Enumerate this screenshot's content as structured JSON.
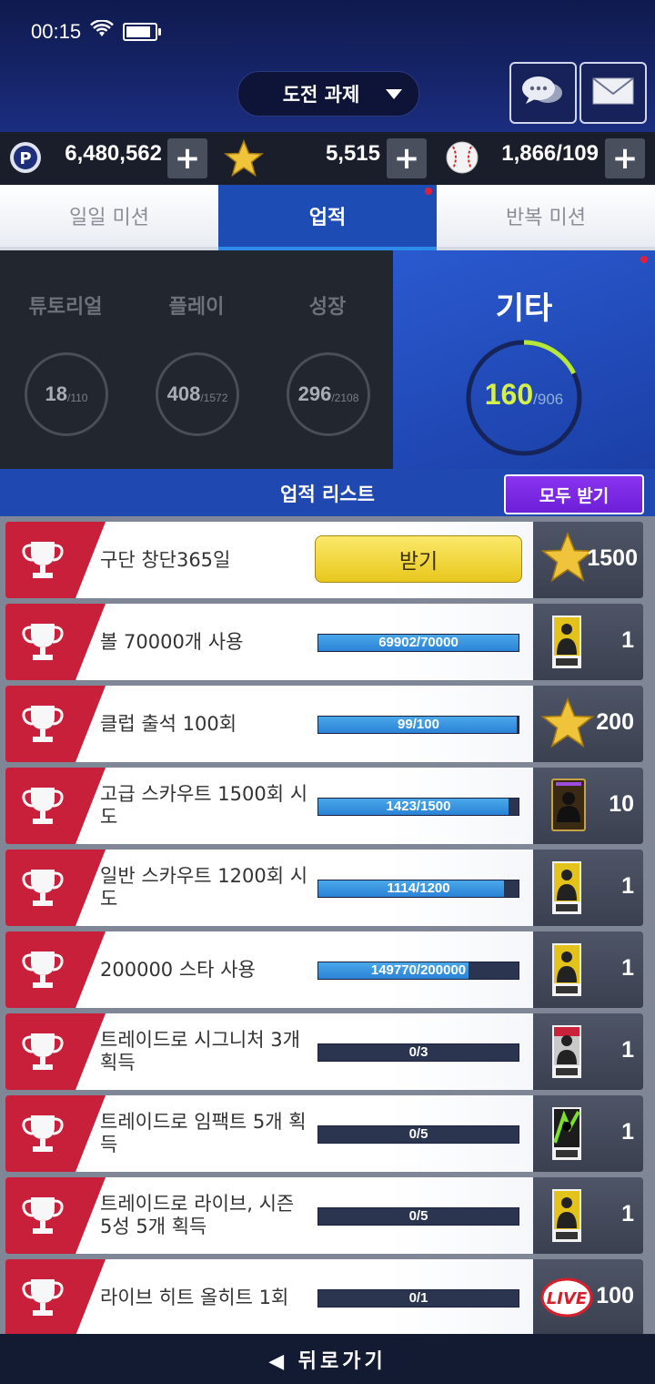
{
  "status": {
    "time": "00:15"
  },
  "header": {
    "dropdown_label": "도전 과제",
    "chat_icon": "chat-bubbles-icon",
    "mail_icon": "mail-envelope-icon"
  },
  "currency": {
    "points": "6,480,562",
    "stars": "5,515",
    "balls": "1,866/109",
    "plus": "+"
  },
  "tabs": [
    {
      "label": "일일 미션"
    },
    {
      "label": "업적"
    },
    {
      "label": "반복 미션"
    }
  ],
  "categories": [
    {
      "name": "튜토리얼",
      "value": "18",
      "total": "/110"
    },
    {
      "name": "플레이",
      "value": "408",
      "total": "/1572"
    },
    {
      "name": "성장",
      "value": "296",
      "total": "/2108"
    },
    {
      "name": "기타",
      "value": "160",
      "total": "/906",
      "progress": 0.177
    }
  ],
  "list_header": {
    "title": "업적 리스트",
    "claim_all": "모두 받기"
  },
  "achievements": [
    {
      "title": "구단 창단365일",
      "action": "받기",
      "reward": "1500",
      "reward_icon": "star-icon"
    },
    {
      "title": "볼 70000개 사용",
      "progress": "69902/70000",
      "fraction": 0.9986,
      "reward": "1",
      "reward_icon": "scout-ticket-icon"
    },
    {
      "title": "클럽 출석 100회",
      "progress": "99/100",
      "fraction": 0.99,
      "reward": "200",
      "reward_icon": "star-icon"
    },
    {
      "title": "고급 스카우트 1500회 시도",
      "progress": "1423/1500",
      "fraction": 0.9487,
      "reward": "10",
      "reward_icon": "enhance-card-icon"
    },
    {
      "title": "일반 스카우트 1200회 시도",
      "progress": "1114/1200",
      "fraction": 0.9283,
      "reward": "1",
      "reward_icon": "scout-ticket-icon"
    },
    {
      "title": "200000 스타 사용",
      "progress": "149770/200000",
      "fraction": 0.7489,
      "reward": "1",
      "reward_icon": "scout-ticket-icon"
    },
    {
      "title": "트레이드로 시그니처 3개 획득",
      "progress": "0/3",
      "fraction": 0,
      "reward": "1",
      "reward_icon": "signature-scout-ticket-icon"
    },
    {
      "title": "트레이드로 임팩트 5개 획득",
      "progress": "0/5",
      "fraction": 0,
      "reward": "1",
      "reward_icon": "impact-scout-ticket-icon"
    },
    {
      "title": "트레이드로 라이브, 시즌 5성 5개 획득",
      "progress": "0/5",
      "fraction": 0,
      "reward": "1",
      "reward_icon": "scout-ticket-icon"
    },
    {
      "title": "라이브 히트 올히트 1회",
      "progress": "0/1",
      "fraction": 0,
      "reward": "100",
      "reward_icon": "live-badge-icon"
    }
  ],
  "footer": {
    "back_label": "◀ 뒤로가기"
  },
  "colors": {
    "accent": "#1d4cb5",
    "trophy_red": "#c81f3b",
    "progress_green": "#b6e83a",
    "claim_purple": "#7a2ae6",
    "receive_yellow": "#f3d73a"
  }
}
